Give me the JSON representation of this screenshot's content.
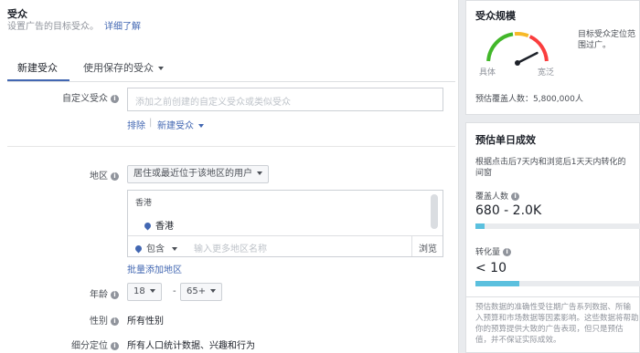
{
  "section": {
    "title": "受众",
    "description": "设置广告的目标受众。",
    "learn_more": "详细了解"
  },
  "tabs": {
    "new": "新建受众",
    "saved": "使用保存的受众"
  },
  "custom_audience": {
    "label": "自定义受众",
    "placeholder": "添加之前创建的自定义受众或类似受众",
    "exclude": "排除",
    "create_new": "新建受众"
  },
  "location": {
    "label": "地区",
    "type": "居住或最近位于该地区的用户",
    "region_header": "香港",
    "selected": "香港",
    "include": "包含",
    "search_placeholder": "输入更多地区名称",
    "browse": "浏览",
    "bulk_add": "批量添加地区"
  },
  "age": {
    "label": "年龄",
    "min": "18",
    "sep": "-",
    "max": "65+"
  },
  "gender": {
    "label": "性别",
    "value": "所有性别"
  },
  "detailed": {
    "label": "细分定位",
    "value": "所有人口统计数据、兴趣和行为"
  },
  "audience_size": {
    "title": "受众规模",
    "left": "具体",
    "right": "宽泛",
    "desc_line1": "目标受众定位范",
    "desc_line2": "围过广。",
    "reach_label": "预估覆盖人数：",
    "reach_value": "5,800,000人",
    "gauge_needle_fraction": 0.85
  },
  "daily_results": {
    "title": "预估单日成效",
    "desc_line1": "根据点击后7天内和浏览后1天天内转化的",
    "desc_line2": "间窗",
    "reach_label": "覆盖人数",
    "reach_value": "680 - 2.0K",
    "reach_fill_fraction": 0.05,
    "conv_label": "转化量",
    "conv_value": "< 10",
    "conv_fill_fraction": 0.25,
    "footnote_line1": "预估数据的准确性受往期广告系列数据、所输",
    "footnote_line2": "入预算和市场数据等因素影响。这些数据将帮助",
    "footnote_line3": "你的预算提供大致的广告表现，但只是预估",
    "footnote_line4": "值，并不保证实际成效。"
  },
  "colors": {
    "accent": "#4267b2",
    "bar": "#5bc0de",
    "gauge_green": "#42b72a",
    "gauge_yellow": "#f7b928",
    "gauge_red": "#fa3e3e"
  }
}
